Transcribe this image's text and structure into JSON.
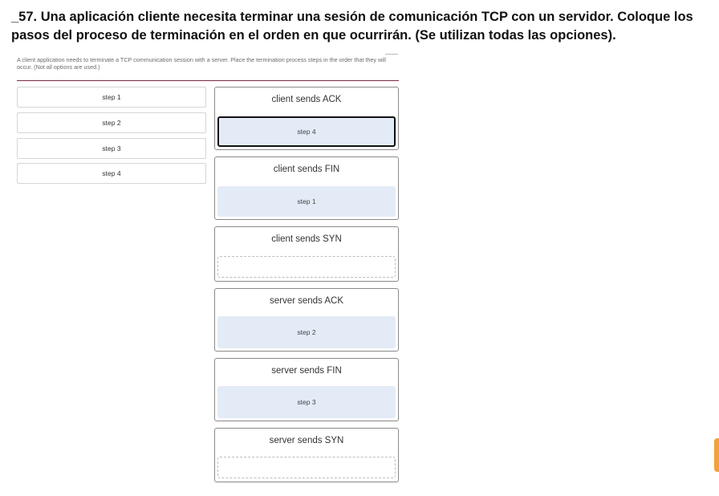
{
  "question": "_57. Una aplicación cliente necesita terminar una sesión de comunicación TCP con un servidor. Coloque los pasos del proceso de terminación en el orden en que ocurrirán. (Se utilizan todas las opciones).",
  "instructions": "A client application needs to terminate a TCP communication session with a server. Place the termination process steps in the order that they will occur. (Not all options are used.)",
  "steps": [
    {
      "label": "step 1"
    },
    {
      "label": "step 2"
    },
    {
      "label": "step 3"
    },
    {
      "label": "step 4"
    }
  ],
  "targets": [
    {
      "label": "client sends ACK",
      "slot": "step 4",
      "state": "selected"
    },
    {
      "label": "client sends FIN",
      "slot": "step 1",
      "state": "filled"
    },
    {
      "label": "client sends SYN",
      "slot": "",
      "state": "empty"
    },
    {
      "label": "server sends ACK",
      "slot": "step 2",
      "state": "filled"
    },
    {
      "label": "server sends FIN",
      "slot": "step 3",
      "state": "filled"
    },
    {
      "label": "server sends SYN",
      "slot": "",
      "state": "empty"
    }
  ],
  "colors": {
    "slot_filled": "#e3ebf6",
    "divider": "#7a2a4a",
    "side_tab": "#f2a23a"
  }
}
